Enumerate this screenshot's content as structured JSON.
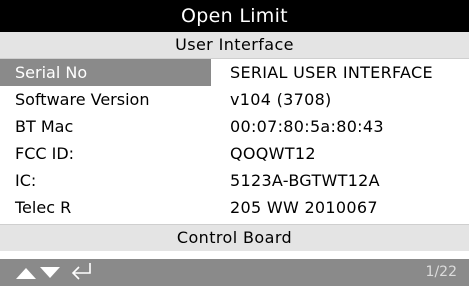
{
  "title": "Open Limit",
  "section_header": "User Interface",
  "rows": [
    {
      "label": "Serial No",
      "value": "SERIAL USER INTERFACE"
    },
    {
      "label": "Software Version",
      "value": "v104 (3708)"
    },
    {
      "label": "BT Mac",
      "value": "00:07:80:5a:80:43"
    },
    {
      "label": "FCC ID:",
      "value": "QOQWT12"
    },
    {
      "label": "IC:",
      "value": "5123A-BGTWT12A"
    },
    {
      "label": "Telec R",
      "value": "205 WW 2010067"
    }
  ],
  "next_section": "Control Board",
  "nav": {
    "icons": [
      "arrow-up-icon",
      "arrow-down-icon",
      "enter-icon"
    ],
    "page_indicator": "1/22"
  },
  "colors": {
    "title_bg": "#000000",
    "header_bg": "#e4e4e4",
    "selected_bg": "#8a8a8a",
    "nav_bg": "#8a8a8a"
  }
}
